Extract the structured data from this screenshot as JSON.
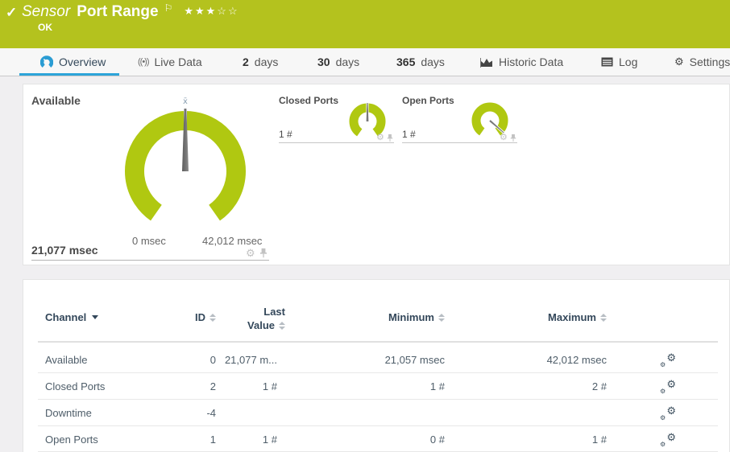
{
  "colors": {
    "status_green": "#b4c21e",
    "gauge_green": "#b0c811",
    "accent_blue": "#2da4d9",
    "header_text_navy": "#33475a"
  },
  "icons": {
    "status": "check-icon ✓",
    "priority_flag": "flag-icon ⚐",
    "star_filled": "★",
    "star_empty": "☆",
    "settings_gear": "⚙",
    "channel_settings": "double-gear-icon",
    "pin": "pushpin-icon"
  },
  "header": {
    "sensor_label": "Sensor",
    "title": "Port Range",
    "status": "OK",
    "stars_filled": "★★★",
    "stars_empty": "☆☆"
  },
  "tabs": {
    "overview": "Overview",
    "live_data": "Live Data",
    "d2_num": "2",
    "d2_label": "days",
    "d30_num": "30",
    "d30_label": "days",
    "d365_num": "365",
    "d365_label": "days",
    "historic": "Historic Data",
    "log": "Log",
    "settings": "Settings",
    "live_glyph": "((•))"
  },
  "gauges": {
    "main": {
      "title": "Available",
      "value": "21,077 msec",
      "min_label": "0 msec",
      "max_label": "42,012 msec",
      "avg_marker": "x̄"
    },
    "closed": {
      "title": "Closed Ports",
      "value": "1 #"
    },
    "open": {
      "title": "Open Ports",
      "value": "1 #"
    }
  },
  "table": {
    "headers": {
      "channel": "Channel",
      "id": "ID",
      "last_line1": "Last",
      "last_line2": "Value",
      "min": "Minimum",
      "max": "Maximum"
    },
    "rows": [
      {
        "channel": "Available",
        "id": "0",
        "last": "21,077 m...",
        "min": "21,057 msec",
        "max": "42,012 msec"
      },
      {
        "channel": "Closed Ports",
        "id": "2",
        "last": "1 #",
        "min": "1 #",
        "max": "2 #"
      },
      {
        "channel": "Downtime",
        "id": "-4",
        "last": "",
        "min": "",
        "max": ""
      },
      {
        "channel": "Open Ports",
        "id": "1",
        "last": "1 #",
        "min": "0 #",
        "max": "1 #"
      }
    ]
  }
}
